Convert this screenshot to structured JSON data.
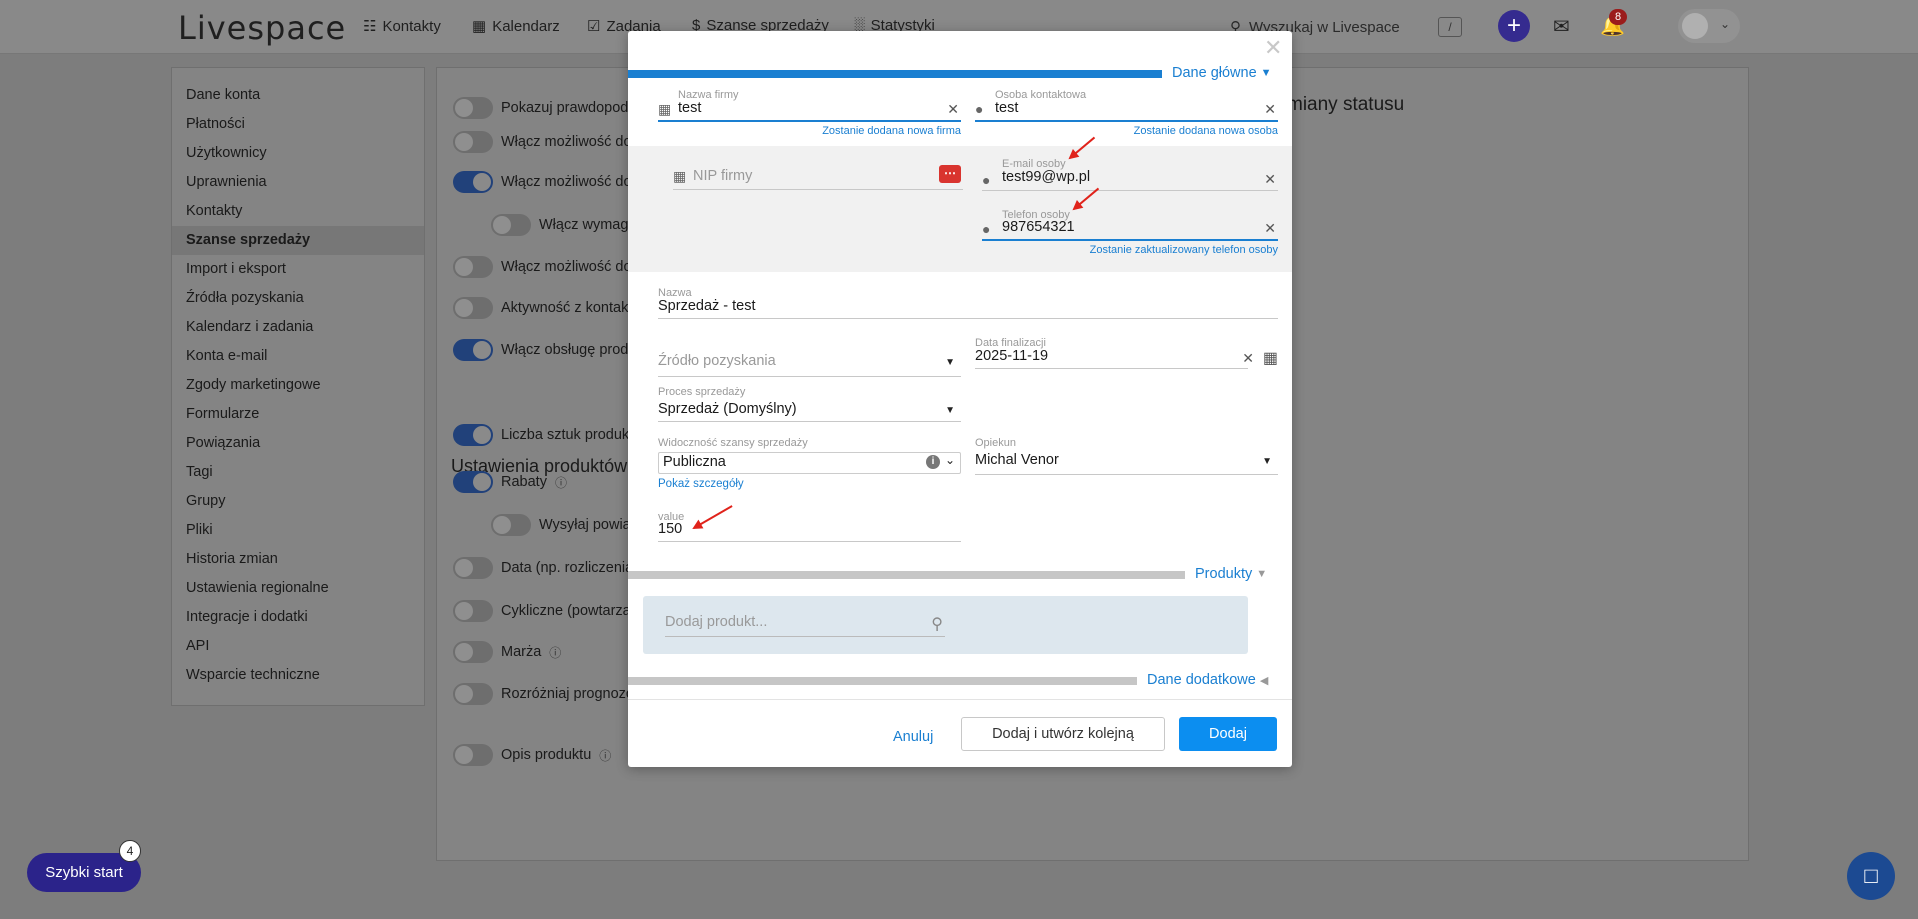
{
  "app": {
    "logo": "Livespace",
    "nav": [
      {
        "label": "Kontakty",
        "icon": "contact-icon"
      },
      {
        "label": "Kalendarz",
        "icon": "calendar-icon"
      },
      {
        "label": "Zadania",
        "icon": "checkbox-icon"
      },
      {
        "label": "Szanse sprzedaży",
        "icon": "dollar-icon"
      },
      {
        "label": "Statystyki",
        "icon": "stats-icon"
      }
    ],
    "search_placeholder": "Wyszukaj w Livespace",
    "search_shortcut": "/",
    "notifications_count": "8"
  },
  "sidebar": {
    "items": [
      {
        "label": "Dane konta"
      },
      {
        "label": "Płatności"
      },
      {
        "label": "Użytkownicy"
      },
      {
        "label": "Uprawnienia"
      },
      {
        "label": "Kontakty"
      },
      {
        "label": "Szanse sprzedaży",
        "active": true
      },
      {
        "label": "Import i eksport"
      },
      {
        "label": "Źródła pozyskania"
      },
      {
        "label": "Kalendarz i zadania"
      },
      {
        "label": "Konta e-mail"
      },
      {
        "label": "Zgody marketingowe"
      },
      {
        "label": "Formularze"
      },
      {
        "label": "Powiązania"
      },
      {
        "label": "Tagi"
      },
      {
        "label": "Grupy"
      },
      {
        "label": "Pliki"
      },
      {
        "label": "Historia zmian"
      },
      {
        "label": "Ustawienia regionalne"
      },
      {
        "label": "Integracje i dodatki"
      },
      {
        "label": "API"
      },
      {
        "label": "Wsparcie techniczne"
      }
    ]
  },
  "settings": {
    "title_fragment": "miany statusu",
    "section_products": "Ustawienia produktów",
    "toggles": [
      {
        "label": "Pokazuj prawdopodo",
        "on": false
      },
      {
        "label": "Włącz możliwość doc",
        "on": false
      },
      {
        "label": "Włącz możliwość doc",
        "on": true
      },
      {
        "label": "Włącz wymaga",
        "on": false
      },
      {
        "label": "Włącz możliwość doc",
        "on": false
      },
      {
        "label": "Aktywność z kontakt",
        "on": false
      },
      {
        "label": "Włącz obsługę produ",
        "on": true
      },
      {
        "label": "Liczba sztuk produkt",
        "on": true
      },
      {
        "label": "Rabaty",
        "on": true
      },
      {
        "label": "Wysyłaj powiad",
        "on": false
      },
      {
        "label": "Data (np. rozliczenia",
        "on": false
      },
      {
        "label": "Cykliczne (powtarzal",
        "on": false
      },
      {
        "label": "Marża",
        "on": false
      },
      {
        "label": "Rozróżniaj prognozo",
        "on": false
      },
      {
        "label": "Opis produktu",
        "on": false
      }
    ]
  },
  "quickstart": {
    "label": "Szybki start",
    "badge": "4"
  },
  "modal": {
    "section_main": "Dane główne",
    "company": {
      "label": "Nazwa firmy",
      "value": "test",
      "hint": "Zostanie dodana nowa firma"
    },
    "person": {
      "label": "Osoba kontaktowa",
      "value": "test",
      "hint": "Zostanie dodana nowa osoba"
    },
    "nip": {
      "placeholder": "NIP firmy"
    },
    "email": {
      "label": "E-mail osoby",
      "value": "test99@wp.pl"
    },
    "phone": {
      "label": "Telefon osoby",
      "value": "987654321",
      "hint": "Zostanie zaktualizowany telefon osoby"
    },
    "name": {
      "label": "Nazwa",
      "value": "Sprzedaż - test"
    },
    "source": {
      "placeholder": "Źródło pozyskania"
    },
    "close_date": {
      "label": "Data finalizacji",
      "value": "2025-11-19"
    },
    "process": {
      "label": "Proces sprzedaży",
      "value": "Sprzedaż (Domyślny)"
    },
    "visibility": {
      "label": "Widoczność szansy sprzedaży",
      "value": "Publiczna",
      "details_link": "Pokaż szczegóły"
    },
    "owner": {
      "label": "Opiekun",
      "value": "Michal Venor"
    },
    "value_field": {
      "label": "value",
      "value": "150"
    },
    "section_products": "Produkty",
    "product_search_placeholder": "Dodaj produkt...",
    "section_additional": "Dane dodatkowe",
    "buttons": {
      "cancel": "Anuluj",
      "add_next": "Dodaj i utwórz kolejną",
      "add": "Dodaj"
    }
  }
}
